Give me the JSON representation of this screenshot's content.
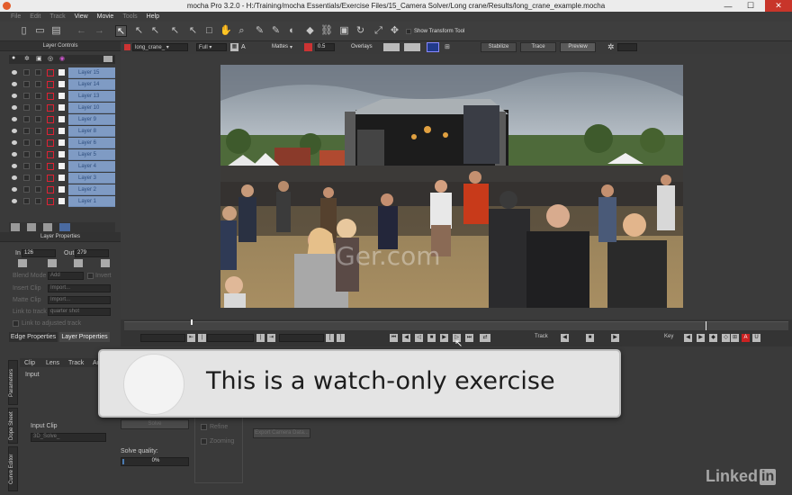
{
  "window": {
    "title": "mocha Pro 3.2.0 - H:/Training/mocha Essentials/Exercise Files/15_Camera Solver/Long crane/Results/long_crane_example.mocha"
  },
  "menu": {
    "items": [
      "File",
      "Edit",
      "Track",
      "View",
      "Movie",
      "Tools",
      "Help"
    ],
    "active": [
      "View",
      "Movie",
      "Help"
    ]
  },
  "toolbar": {
    "show_transform_tool": "Show Transform Tool",
    "clip_select": "long_crane_",
    "resolution": "Full",
    "mattes_label": "Mattes",
    "opacity_value": "0.5",
    "overlays_label": "Overlays",
    "stabilize": "Stabilize",
    "trace": "Trace",
    "preview": "Preview"
  },
  "layer_controls": {
    "title": "Layer Controls",
    "layers": [
      "Layer 15",
      "Layer 14",
      "Layer 13",
      "Layer 10",
      "Layer 9",
      "Layer 8",
      "Layer 6",
      "Layer 5",
      "Layer 4",
      "Layer 3",
      "Layer 2",
      "Layer 1"
    ]
  },
  "layer_properties": {
    "title": "Layer Properties",
    "in_label": "In",
    "in_value": "126",
    "out_label": "Out",
    "out_value": "279",
    "blend_mode_label": "Blend Mode",
    "blend_mode_value": "Add",
    "invert_label": "Invert",
    "insert_clip_label": "Insert Clip",
    "insert_clip_value": "Import...",
    "matte_clip_label": "Matte Clip",
    "matte_clip_value": "Import...",
    "link_to_track_label": "Link to track",
    "link_to_track_value": "quarter shot",
    "link_adjusted_label": "Link to adjusted track",
    "tab_edge": "Edge Properties",
    "tab_layer": "Layer Properties"
  },
  "bottom_tabs": [
    "Clip",
    "Lens",
    "Track",
    "Ad"
  ],
  "side_tabs": [
    "Parameters",
    "Dope Sheet",
    "Curve Editor"
  ],
  "bottom": {
    "input_label": "Input",
    "input_clip_label": "Input Clip",
    "input_clip_value": "3D_Solve_",
    "solve_label": "Solve",
    "solve_quality_label": "Solve quality:",
    "solve_quality_value": "0%",
    "refine_label": "Refine",
    "zooming_label": "Zooming",
    "export_label": "Export Camera Data..."
  },
  "transport": {
    "track_label": "Track",
    "key_label": "Key"
  },
  "overlay": {
    "message": "This is a watch-only exercise",
    "watermark": "LinkedIn",
    "logo_word": "Linked",
    "logo_in": "in",
    "center_wm": "Ger.com"
  }
}
